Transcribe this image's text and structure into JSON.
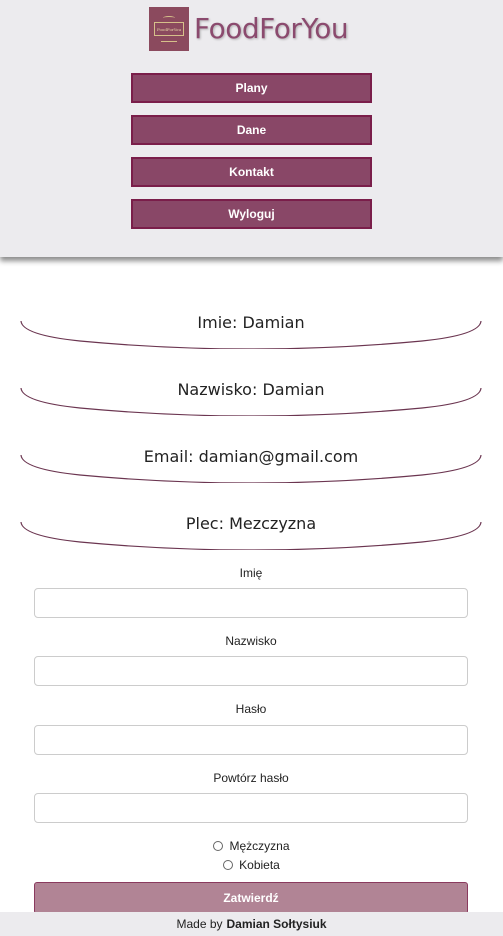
{
  "brand": {
    "logo_text": "FoodForYou",
    "name": "FoodForYou"
  },
  "nav": [
    {
      "label": "Plany"
    },
    {
      "label": "Dane"
    },
    {
      "label": "Kontakt"
    },
    {
      "label": "Wyloguj"
    }
  ],
  "info": [
    {
      "text": "Imie: Damian"
    },
    {
      "text": "Nazwisko: Damian"
    },
    {
      "text": "Email: damian@gmail.com"
    },
    {
      "text": "Plec: Mezczyzna"
    }
  ],
  "form": {
    "fields": [
      {
        "label": "Imię",
        "value": ""
      },
      {
        "label": "Nazwisko",
        "value": ""
      },
      {
        "label": "Hasło",
        "value": ""
      },
      {
        "label": "Powtórz hasło",
        "value": ""
      }
    ],
    "gender_options": [
      {
        "label": "Mężczyzna"
      },
      {
        "label": "Kobieta"
      }
    ],
    "submit_label": "Zatwierdź"
  },
  "footer": {
    "prefix": "Made by",
    "author": "Damian Sołtysiuk"
  },
  "colors": {
    "accent": "#894767",
    "accent_border": "#7a1e4a",
    "submit": "#b18495",
    "header_bg": "#ecebee"
  }
}
